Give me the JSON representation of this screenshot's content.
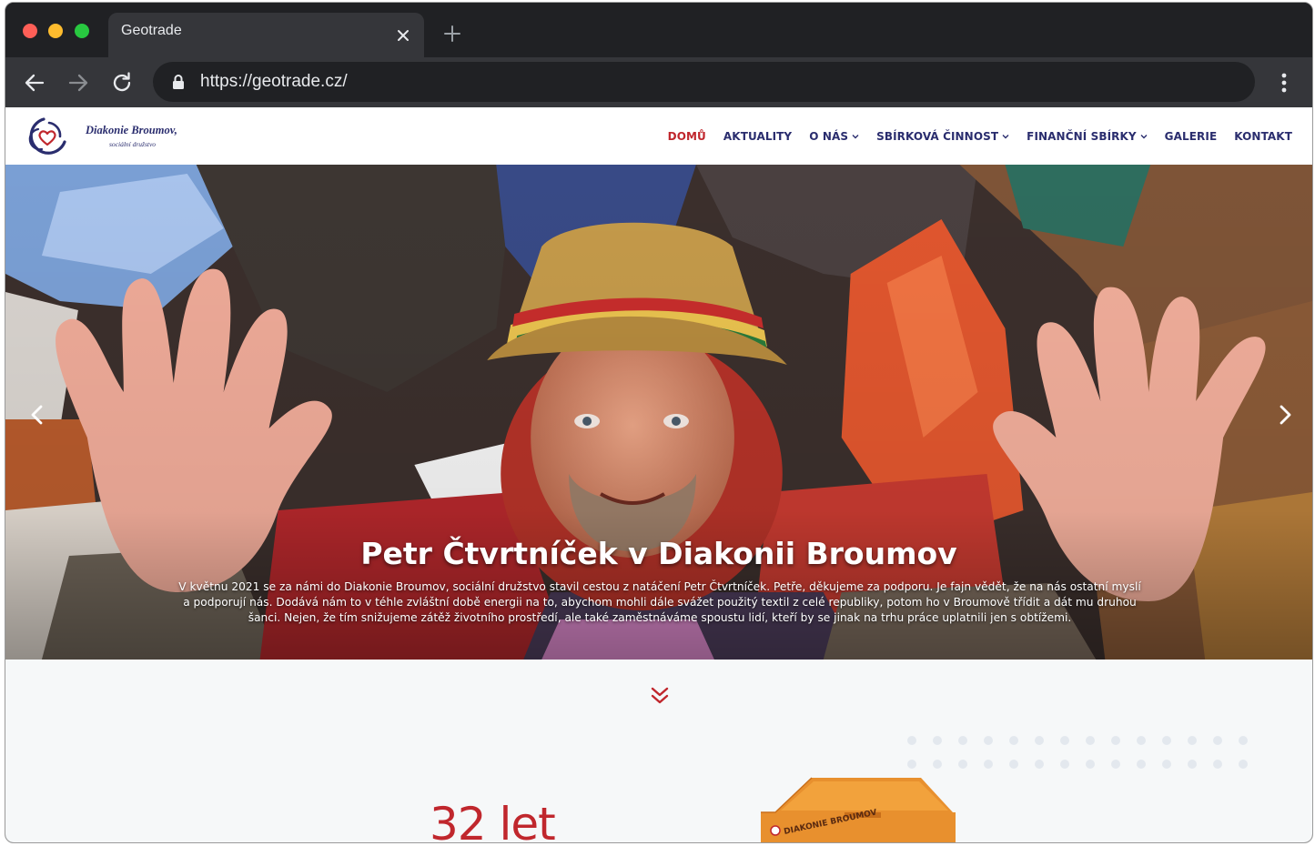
{
  "browser": {
    "tab_title": "Geotrade",
    "url": "https://geotrade.cz/",
    "icons": [
      "close-icon",
      "plus-icon",
      "arrow-left-icon",
      "arrow-right-icon",
      "reload-icon",
      "lock-icon",
      "kebab-menu-icon"
    ]
  },
  "site": {
    "logo": {
      "name": "Diakonie Broumov,",
      "subtitle": "sociální družstvo"
    },
    "nav": [
      {
        "label": "DOMŮ",
        "active": true,
        "dropdown": false
      },
      {
        "label": "AKTUALITY",
        "active": false,
        "dropdown": false
      },
      {
        "label": "O NÁS",
        "active": false,
        "dropdown": true
      },
      {
        "label": "SBÍRKOVÁ ČINNOST",
        "active": false,
        "dropdown": true
      },
      {
        "label": "FINANČNÍ SBÍRKY",
        "active": false,
        "dropdown": true
      },
      {
        "label": "GALERIE",
        "active": false,
        "dropdown": false
      },
      {
        "label": "KONTAKT",
        "active": false,
        "dropdown": false
      }
    ]
  },
  "hero": {
    "title": "Petr Čtvrtníček v Diakonii Broumov",
    "text": "V květnu 2021 se za námi do Diakonie Broumov, sociální družstvo stavil cestou z natáčení Petr Čtvrtníček. Petře, děkujeme za podporu. Je fajn vědět, že na nás ostatní myslí a podporují nás. Dodává nám to v téhle zvláštní době energii na to, abychom mohli dále svážet použitý textil z celé republiky, potom ho v Broumově třídit a dát mu druhou šanci. Nejen, že tím snižujeme zátěž životního prostředí, ale také zaměstnáváme spoustu lidí, kteří by se jinak na trhu práce uplatnili jen s obtížemi."
  },
  "section": {
    "years": "32 let",
    "container_label": "DIAKONIE BROUMOV"
  },
  "colors": {
    "brand_red": "#c0272d",
    "brand_navy": "#2a2d6e",
    "chrome_dark": "#202124",
    "chrome_tab": "#35363a"
  }
}
